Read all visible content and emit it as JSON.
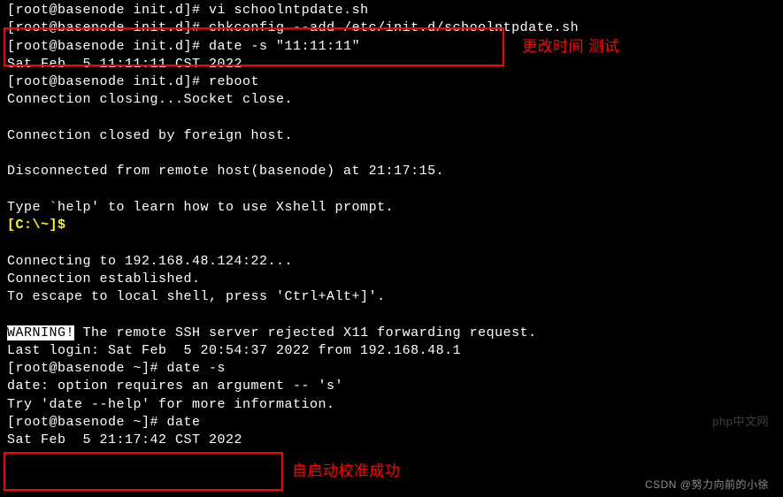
{
  "lines": {
    "l0_prefix": "[root@basenode init.d]# ",
    "l0_cmd_partial": "vi schoolntpdate.sh",
    "l1_prefix": "[root@basenode init.d]# ",
    "l1_cmd": "chkconfig --add /etc/init.d/schoolntpdate.sh",
    "l2_prefix": "[root@basenode init.d]# ",
    "l2_cmd": "date -s \"11:11:11\"",
    "l3": "Sat Feb  5 11:11:11 CST 2022",
    "l4_prefix": "[root@basenode init.d]# ",
    "l4_cmd": "reboot",
    "l5": "Connection closing...Socket close.",
    "l6": "",
    "l7": "Connection closed by foreign host.",
    "l8": "",
    "l9": "Disconnected from remote host(basenode) at 21:17:15.",
    "l10": "",
    "l11": "Type `help' to learn how to use Xshell prompt.",
    "l12_prompt": "[C:\\~]$",
    "l13": "",
    "l14": "Connecting to 192.168.48.124:22...",
    "l15": "Connection established.",
    "l16": "To escape to local shell, press 'Ctrl+Alt+]'.",
    "l17": "",
    "l18_warn": "WARNING!",
    "l18_rest": " The remote SSH server rejected X11 forwarding request.",
    "l19": "Last login: Sat Feb  5 20:54:37 2022 from 192.168.48.1",
    "l20_prefix": "[root@basenode ~]# ",
    "l20_cmd": "date -s",
    "l21": "date: option requires an argument -- 's'",
    "l22": "Try 'date --help' for more information.",
    "l23_prefix": "[root@basenode ~]# ",
    "l23_cmd": "date",
    "l24": "Sat Feb  5 21:17:42 CST 2022"
  },
  "annotations": {
    "a1": "更改时间 测试",
    "a2": "自启动校准成功"
  },
  "watermark": "CSDN @努力向前的小徐",
  "watermark2": "php中文网"
}
